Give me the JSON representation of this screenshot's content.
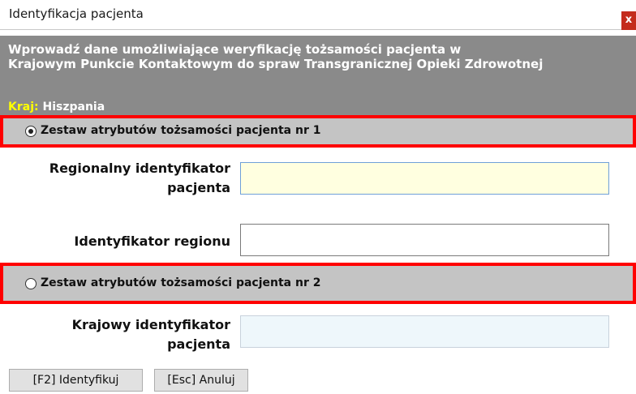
{
  "window": {
    "title": "Identyfikacja pacjenta",
    "close_label": "x"
  },
  "header": {
    "line1": "Wprowadź dane umożliwiające weryfikację tożsamości pacjenta w",
    "line2": "Krajowym Punkcie Kontaktowym do spraw Transgranicznej Opieki Zdrowotnej",
    "country_label": "Kraj:",
    "country_value": "Hiszpania"
  },
  "section1": {
    "label": "Zestaw atrybutów tożsamości pacjenta nr 1",
    "selected": true,
    "fields": [
      {
        "label_line1": "Regionalny identyfikator",
        "label_line2": "pacjenta",
        "value": ""
      },
      {
        "label": "Identyfikator regionu",
        "value": ""
      }
    ]
  },
  "section2": {
    "label": "Zestaw atrybutów tożsamości pacjenta nr 2",
    "selected": false,
    "fields": [
      {
        "label_line1": "Krajowy identyfikator",
        "label_line2": "pacjenta",
        "value": ""
      }
    ]
  },
  "footer": {
    "identify_label": "[F2] Identyfikuj",
    "cancel_label": "[Esc] Anuluj"
  }
}
